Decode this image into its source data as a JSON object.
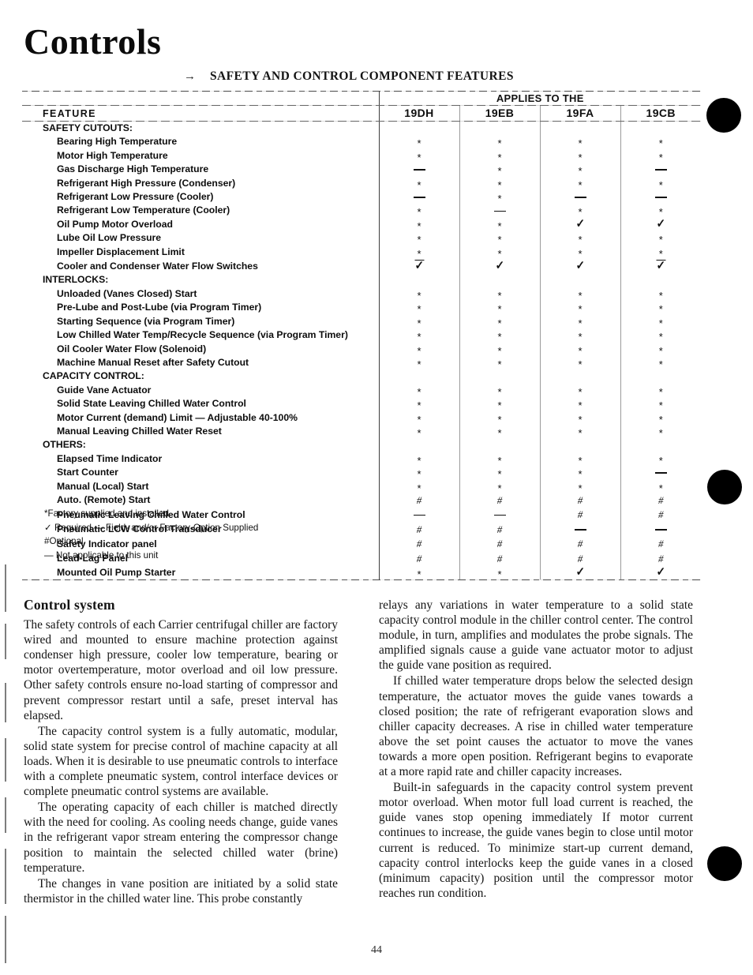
{
  "page": {
    "title": "Controls",
    "number": "44",
    "arrow_icon": "→"
  },
  "table": {
    "caption": "SAFETY AND CONTROL COMPONENT FEATURES",
    "feature_header": "FEATURE",
    "applies_header": "APPLIES TO THE",
    "models": [
      "19DH",
      "19EB",
      "19FA",
      "19CB"
    ],
    "groups": [
      {
        "heading": "SAFETY CUTOUTS:",
        "rows": [
          {
            "label": "Bearing High Temperature",
            "marks": [
              "*",
              "*",
              "*",
              "*"
            ]
          },
          {
            "label": "Motor High Temperature",
            "marks": [
              "*",
              "*",
              "*",
              "*"
            ]
          },
          {
            "label": "Gas Discharge High Temperature",
            "marks": [
              "—",
              "*",
              "*",
              "—"
            ]
          },
          {
            "label": "Refrigerant High Pressure (Condenser)",
            "marks": [
              "*",
              "*",
              "*",
              "*"
            ]
          },
          {
            "label": "Refrigerant Low Pressure (Cooler)",
            "marks": [
              "—",
              "*",
              "—",
              "—"
            ]
          },
          {
            "label": "Refrigerant Low Temperature (Cooler)",
            "marks": [
              "*",
              "—",
              "*",
              "*"
            ]
          },
          {
            "label": "Oil Pump Motor Overload",
            "marks": [
              "*",
              "*",
              "✓",
              "✓"
            ]
          },
          {
            "label": "Lube Oil Low Pressure",
            "marks": [
              "*",
              "*",
              "*",
              "*"
            ]
          },
          {
            "label": "Impeller Displacement Limit",
            "marks": [
              "*",
              "*",
              "*",
              "*"
            ]
          },
          {
            "label": "Cooler and Condenser Water Flow Switches",
            "marks": [
              "✓̄",
              "✓",
              "✓",
              "✓̄"
            ]
          }
        ]
      },
      {
        "heading": "INTERLOCKS:",
        "rows": [
          {
            "label": "Unloaded (Vanes Closed) Start",
            "marks": [
              "*",
              "*",
              "*",
              "*"
            ]
          },
          {
            "label": "Pre-Lube and Post-Lube (via Program Timer)",
            "marks": [
              "*",
              "*",
              "*",
              "*"
            ]
          },
          {
            "label": "Starting Sequence (via Program Timer)",
            "marks": [
              "*",
              "*",
              "*",
              "*"
            ]
          },
          {
            "label": "Low Chilled Water Temp/Recycle Sequence (via Program Timer)",
            "marks": [
              "*",
              "*",
              "*",
              "*"
            ]
          },
          {
            "label": "Oil Cooler Water Flow (Solenoid)",
            "marks": [
              "*",
              "*",
              "*",
              "*"
            ]
          },
          {
            "label": "Machine Manual Reset after Safety Cutout",
            "marks": [
              "*",
              "*",
              "*",
              "*"
            ]
          }
        ]
      },
      {
        "heading": "CAPACITY CONTROL:",
        "rows": [
          {
            "label": "Guide Vane Actuator",
            "marks": [
              "*",
              "*",
              "*",
              "*"
            ]
          },
          {
            "label": "Solid State Leaving Chilled Water Control",
            "marks": [
              "*",
              "*",
              "*",
              "*"
            ]
          },
          {
            "label": "Motor Current (demand) Limit — Adjustable 40-100%",
            "marks": [
              "*",
              "*",
              "*",
              "*"
            ]
          },
          {
            "label": "Manual Leaving Chilled Water Reset",
            "marks": [
              "*",
              "*",
              "*",
              "*"
            ]
          }
        ]
      },
      {
        "heading": "OTHERS:",
        "rows": [
          {
            "label": "Elapsed Time Indicator",
            "marks": [
              "*",
              "*",
              "*",
              "*"
            ]
          },
          {
            "label": "Start Counter",
            "marks": [
              "*",
              "*",
              "*",
              "—"
            ]
          },
          {
            "label": "Manual (Local) Start",
            "marks": [
              "*",
              "*",
              "*",
              "*"
            ]
          },
          {
            "label": "Auto. (Remote) Start",
            "marks": [
              "#",
              "#",
              "#",
              "#"
            ]
          },
          {
            "label": "Pneumatic Leaving Chilled Water Control",
            "marks": [
              "—",
              "—",
              "#",
              "#"
            ]
          },
          {
            "label": "Pneumatic LCW Control Transducer",
            "marks": [
              "#",
              "#",
              "—",
              "—"
            ]
          },
          {
            "label": "Safety Indicator panel",
            "marks": [
              "#",
              "#",
              "#",
              "#"
            ]
          },
          {
            "label": "Lead-Lag Panel",
            "marks": [
              "#",
              "#",
              "#",
              "#"
            ]
          },
          {
            "label": "Mounted Oil Pump Starter",
            "marks": [
              "*",
              "*",
              "✓",
              "✓"
            ]
          }
        ]
      }
    ],
    "footnotes": [
      {
        "mark": "*",
        "text": "Factory supplied and installed"
      },
      {
        "mark": "✓",
        "text": " Required — Field- and/or Factory-Option Supplied"
      },
      {
        "mark": "#",
        "text": "Optional"
      },
      {
        "mark": "—",
        "text": " Not applicable to this unit"
      }
    ]
  },
  "body": {
    "left_heading": "Control system",
    "left_paragraphs": [
      "The safety controls of each Carrier centrifugal chiller are factory wired and mounted to ensure machine protection against condenser high pressure, cooler low temperature, bearing or motor overtemperature, motor overload and oil low pressure. Other safety controls ensure no-load starting of compressor and prevent compressor restart until a safe, preset interval has elapsed.",
      "The capacity control system is a fully automatic, modular, solid state system for precise control of machine capacity at all loads. When it is desirable to use pneumatic controls to interface with a complete pneumatic system, control interface devices or complete pneumatic control systems are available.",
      "The operating capacity of each chiller is matched directly with the need for cooling. As cooling needs change, guide vanes in the refrigerant vapor stream entering the compressor change position to maintain the selected chilled water (brine) temperature.",
      "The changes in vane position are initiated by a solid state thermistor in the chilled water line. This probe constantly"
    ],
    "right_paragraphs": [
      "relays any variations in water temperature to a solid state capacity control module in the chiller control center. The control module, in turn, amplifies and modulates the probe signals. The amplified signals cause a guide vane actuator motor to adjust the guide vane position as required.",
      "If chilled water temperature drops below the selected design temperature, the actuator moves the guide vanes towards a closed position; the rate of refrigerant evaporation slows and chiller capacity decreases. A rise in chilled water temperature above the set point causes the actuator to move the vanes towards a more open position. Refrigerant begins to evaporate at a more rapid rate and chiller capacity increases.",
      "Built-in safeguards in the capacity control system prevent motor overload. When motor full load current is reached, the guide vanes stop opening immediately If motor current continues to increase, the guide vanes begin to close until motor current is reduced. To minimize start-up current demand, capacity control interlocks keep the guide vanes in a closed (minimum capacity) position until the compressor motor reaches run condition."
    ]
  }
}
